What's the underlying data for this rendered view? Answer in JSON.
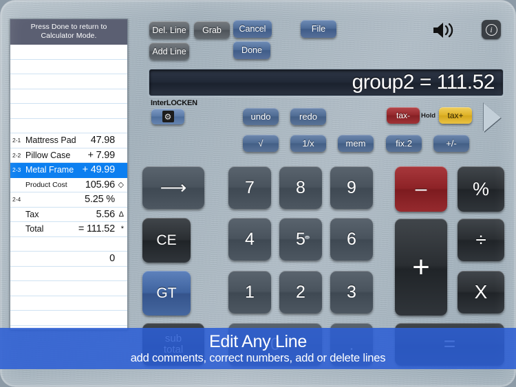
{
  "tape": {
    "header": "Press Done to return to Calculator Mode.",
    "rows": [
      {
        "index": "",
        "label": "",
        "value": "",
        "suffix": "",
        "selected": false,
        "small": false
      },
      {
        "index": "",
        "label": "",
        "value": "",
        "suffix": "",
        "selected": false,
        "small": false
      },
      {
        "index": "",
        "label": "",
        "value": "",
        "suffix": "",
        "selected": false,
        "small": false
      },
      {
        "index": "",
        "label": "",
        "value": "",
        "suffix": "",
        "selected": false,
        "small": false
      },
      {
        "index": "",
        "label": "",
        "value": "",
        "suffix": "",
        "selected": false,
        "small": false
      },
      {
        "index": "",
        "label": "",
        "value": "",
        "suffix": "",
        "selected": false,
        "small": false
      },
      {
        "index": "2-1",
        "label": "Mattress Pad",
        "value": "47.98",
        "suffix": "",
        "selected": false,
        "small": false
      },
      {
        "index": "2-2",
        "label": "Pillow Case",
        "value": "+ 7.99",
        "suffix": "",
        "selected": false,
        "small": false
      },
      {
        "index": "2-3",
        "label": "Metal Frame",
        "value": "+ 49.99",
        "suffix": "",
        "selected": true,
        "small": false
      },
      {
        "index": "",
        "label": "Product Cost",
        "value": "105.96",
        "suffix": "◇",
        "selected": false,
        "small": true
      },
      {
        "index": "2-4",
        "label": "",
        "value": "5.25 %",
        "suffix": "",
        "selected": false,
        "small": false
      },
      {
        "index": "",
        "label": "Tax",
        "value": "5.56",
        "suffix": "Δ",
        "selected": false,
        "small": false
      },
      {
        "index": "",
        "label": "Total",
        "value": "= 111.52",
        "suffix": "*",
        "selected": false,
        "small": false
      },
      {
        "index": "",
        "label": "",
        "value": "",
        "suffix": "",
        "selected": false,
        "small": false
      },
      {
        "index": "",
        "label": "",
        "value": "0",
        "suffix": "",
        "selected": false,
        "small": false
      },
      {
        "index": "",
        "label": "",
        "value": "",
        "suffix": "",
        "selected": false,
        "small": false
      },
      {
        "index": "",
        "label": "",
        "value": "",
        "suffix": "",
        "selected": false,
        "small": false
      },
      {
        "index": "",
        "label": "",
        "value": "",
        "suffix": "",
        "selected": false,
        "small": false
      },
      {
        "index": "",
        "label": "",
        "value": "",
        "suffix": "",
        "selected": false,
        "small": false
      },
      {
        "index": "",
        "label": "",
        "value": "",
        "suffix": "",
        "selected": false,
        "small": false
      },
      {
        "index": "",
        "label": "",
        "value": "",
        "suffix": "",
        "selected": false,
        "small": false
      }
    ]
  },
  "toolbar": {
    "del_line": "Del. Line",
    "grab": "Grab",
    "cancel": "Cancel",
    "file": "File",
    "add_line": "Add Line",
    "done": "Done"
  },
  "display": {
    "value": "group2 = 111.52"
  },
  "brand": {
    "pre": "Inter",
    "mid": "L",
    "ring": "O",
    "post": "CKEN",
    "gear_icon": "⚙"
  },
  "edit_row": {
    "undo": "undo",
    "redo": "redo",
    "tax_minus": "tax-",
    "hold": "Hold",
    "tax_plus": "tax+"
  },
  "function_row": {
    "sqrt": "√",
    "reciprocal": "1/x",
    "mem": "mem",
    "fix": "fix.2",
    "sign": "+/-"
  },
  "keypad": {
    "forward": "⟶",
    "ce": "CE",
    "gt": "GT",
    "sub_total_line1": "sub",
    "sub_total_line2": "total",
    "d7": "7",
    "d8": "8",
    "d9": "9",
    "d4": "4",
    "d5": "5",
    "d6": "6",
    "d1": "1",
    "d2": "2",
    "d3": "3",
    "d0": "0",
    "dot": ".",
    "minus": "–",
    "plus": "+",
    "percent": "%",
    "divide": "÷",
    "multiply": "X",
    "equals": "="
  },
  "promo": {
    "title": "Edit Any Line",
    "subtitle": "add comments, correct numbers, add or delete lines"
  },
  "colors": {
    "selection_blue": "#0c7ff0",
    "promo_blue": "#2c5fd4",
    "tax_minus_red": "#8d2226",
    "tax_plus_gold": "#e2b428",
    "minus_red": "#8d2226"
  }
}
